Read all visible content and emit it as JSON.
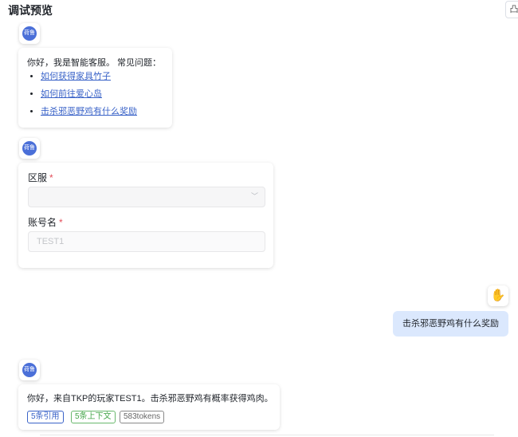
{
  "header": {
    "title": "调试预览",
    "corner_icon": "chat-icon",
    "corner_glyph": "凸"
  },
  "bot": {
    "avatar_text": "荷鲁",
    "avatar_color": "#4a6fd8"
  },
  "greeting": {
    "intro": "你好，我是智能客服。 常见问题：",
    "questions": [
      "如何获得家具竹子",
      "如何前往爱心岛",
      "击杀邪恶野鸡有什么奖励"
    ]
  },
  "form": {
    "region_label": "区服",
    "region_value": "",
    "account_label": "账号名",
    "account_placeholder": "TEST1",
    "required_mark": "*"
  },
  "user_message": {
    "text": "击杀邪恶野鸡有什么奖励",
    "bubble_color": "#dbe8fd"
  },
  "answer": {
    "text": "你好，来自TKP的玩家TEST1。击杀邪恶野鸡有概率获得鸡肉。",
    "tags": {
      "references": "5条引用",
      "context": "5条上下文",
      "tokens": "583tokens"
    }
  }
}
